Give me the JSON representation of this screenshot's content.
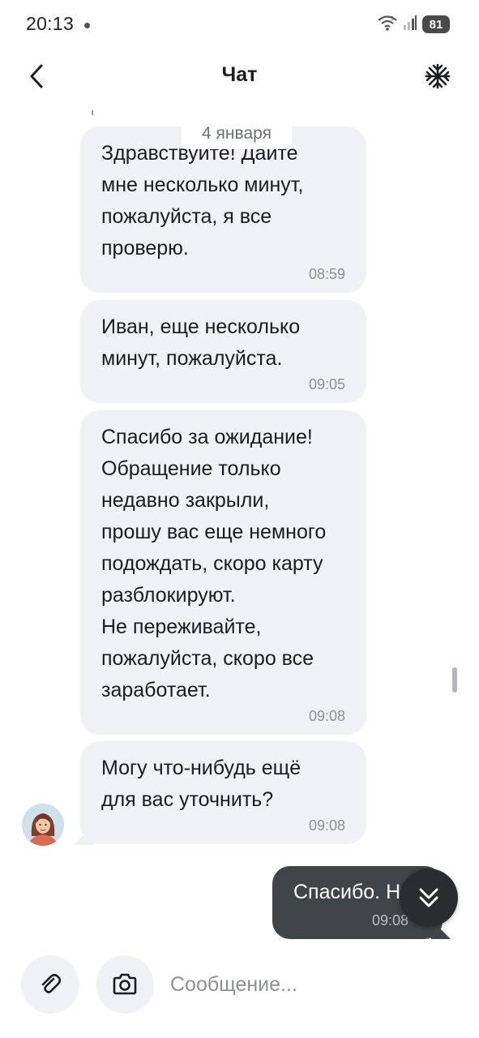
{
  "status_bar": {
    "time": "20:13",
    "battery": "81",
    "icons": [
      "wifi-icon",
      "signal-icon",
      "battery-icon"
    ]
  },
  "header": {
    "title": "Чат",
    "back_icon": "chevron-left-icon",
    "settings_icon": "snowflake-icon"
  },
  "chat": {
    "date_label": "4 января",
    "messages_in": [
      {
        "text": "Здравствуйте! Дайте\nмне несколько минут,\nпожалуйста, я все\nпроверю.",
        "time": "08:59"
      },
      {
        "text": "Иван, еще несколько\nминут, пожалуйста.",
        "time": "09:05"
      },
      {
        "text": "Спасибо за ожидание!\nОбращение только\nнедавно закрыли,\nпрошу вас еще немного\nподождать, скоро карту\nразблокируют.\nНе переживайте,\nпожалуйста, скоро все\nзаработает.",
        "time": "09:08"
      },
      {
        "text": "Могу что-нибудь ещё\nдля вас уточнить?",
        "time": "09:08"
      }
    ],
    "message_out": {
      "text": "Спасибо. Н",
      "time": "09:08"
    }
  },
  "composer": {
    "placeholder": "Сообщение...",
    "attach_icon": "paperclip-icon",
    "camera_icon": "camera-icon"
  },
  "colors": {
    "incoming_bubble": "#f0f1f5",
    "outgoing_bubble": "#3f4548",
    "scroll_button": "#2a2d30"
  }
}
